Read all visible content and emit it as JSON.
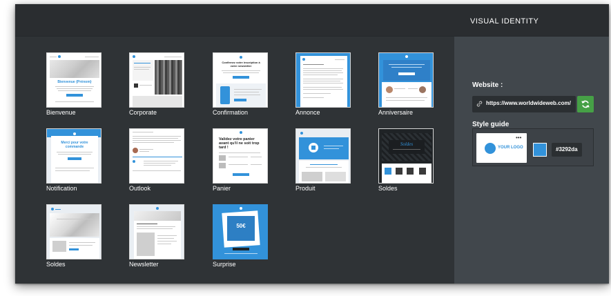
{
  "panel": {
    "title": "VISUAL IDENTITY",
    "website_label": "Website  :",
    "website_url": "https://www.worldwideweb.com/",
    "style_guide_label": "Style guide",
    "logo_text": "YOUR LOGO",
    "color_hex": "#3292da",
    "brand_color": "#3292da",
    "refresh_color": "#46a046"
  },
  "templates": [
    {
      "label": "Bienvenue",
      "thumb_title": "Bienvenue {Prénom}"
    },
    {
      "label": "Corporate"
    },
    {
      "label": "Confirmation",
      "thumb_title": "Confirmez votre inscription à votre newsletter"
    },
    {
      "label": "Annonce"
    },
    {
      "label": "Anniversaire"
    },
    {
      "label": "Notification",
      "thumb_title": "Merci pour votre commande"
    },
    {
      "label": "Outlook"
    },
    {
      "label": "Panier",
      "thumb_title": "Validez votre panier avant qu'il ne soit trop tard !"
    },
    {
      "label": "Produit"
    },
    {
      "label": "Soldes",
      "thumb_title": "Soldes"
    },
    {
      "label": "Soldes"
    },
    {
      "label": "Newsletter"
    },
    {
      "label": "Surprise",
      "thumb_title": "50€"
    }
  ]
}
